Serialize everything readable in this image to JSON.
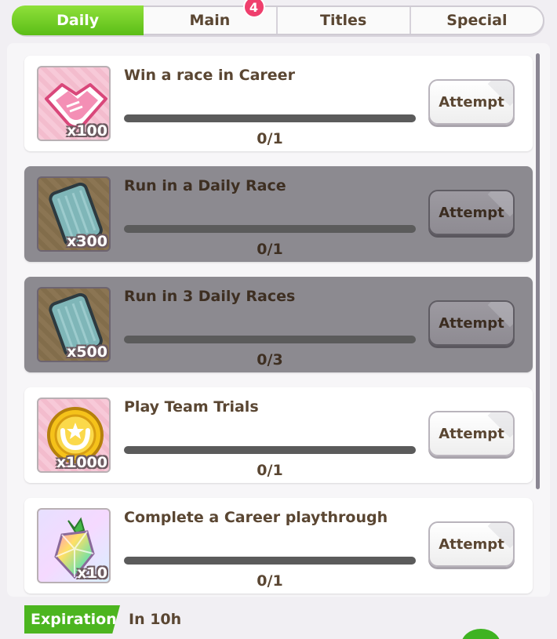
{
  "tabs": [
    {
      "label": "Daily",
      "active": true
    },
    {
      "label": "Main",
      "badge": "4"
    },
    {
      "label": "Titles"
    },
    {
      "label": "Special"
    }
  ],
  "missions": [
    {
      "title": "Win a race in Career",
      "reward_icon": "support-handshake-icon",
      "reward_qty": "x100",
      "progress": "0/1",
      "progress_fraction": 0,
      "button": "Attempt",
      "dimmed": false
    },
    {
      "title": "Run in a Daily Race",
      "reward_icon": "ticket-card-icon",
      "reward_qty": "x300",
      "progress": "0/1",
      "progress_fraction": 0,
      "button": "Attempt",
      "dimmed": true
    },
    {
      "title": "Run in 3 Daily Races",
      "reward_icon": "ticket-card-icon",
      "reward_qty": "x500",
      "progress": "0/3",
      "progress_fraction": 0,
      "button": "Attempt",
      "dimmed": true
    },
    {
      "title": "Play Team Trials",
      "reward_icon": "gold-coin-icon",
      "reward_qty": "x1000",
      "progress": "0/1",
      "progress_fraction": 0,
      "button": "Attempt",
      "dimmed": false
    },
    {
      "title": "Complete a Career playthrough",
      "reward_icon": "rainbow-gem-icon",
      "reward_qty": "x10",
      "progress": "0/1",
      "progress_fraction": 0,
      "button": "Attempt",
      "dimmed": false
    }
  ],
  "footer": {
    "expiration_label": "Expiration",
    "expiration_value": "In 10h"
  },
  "colors": {
    "accent_green": "#5bbd17",
    "badge_pink": "#ef3f6d",
    "text_brown": "#5a4632"
  }
}
